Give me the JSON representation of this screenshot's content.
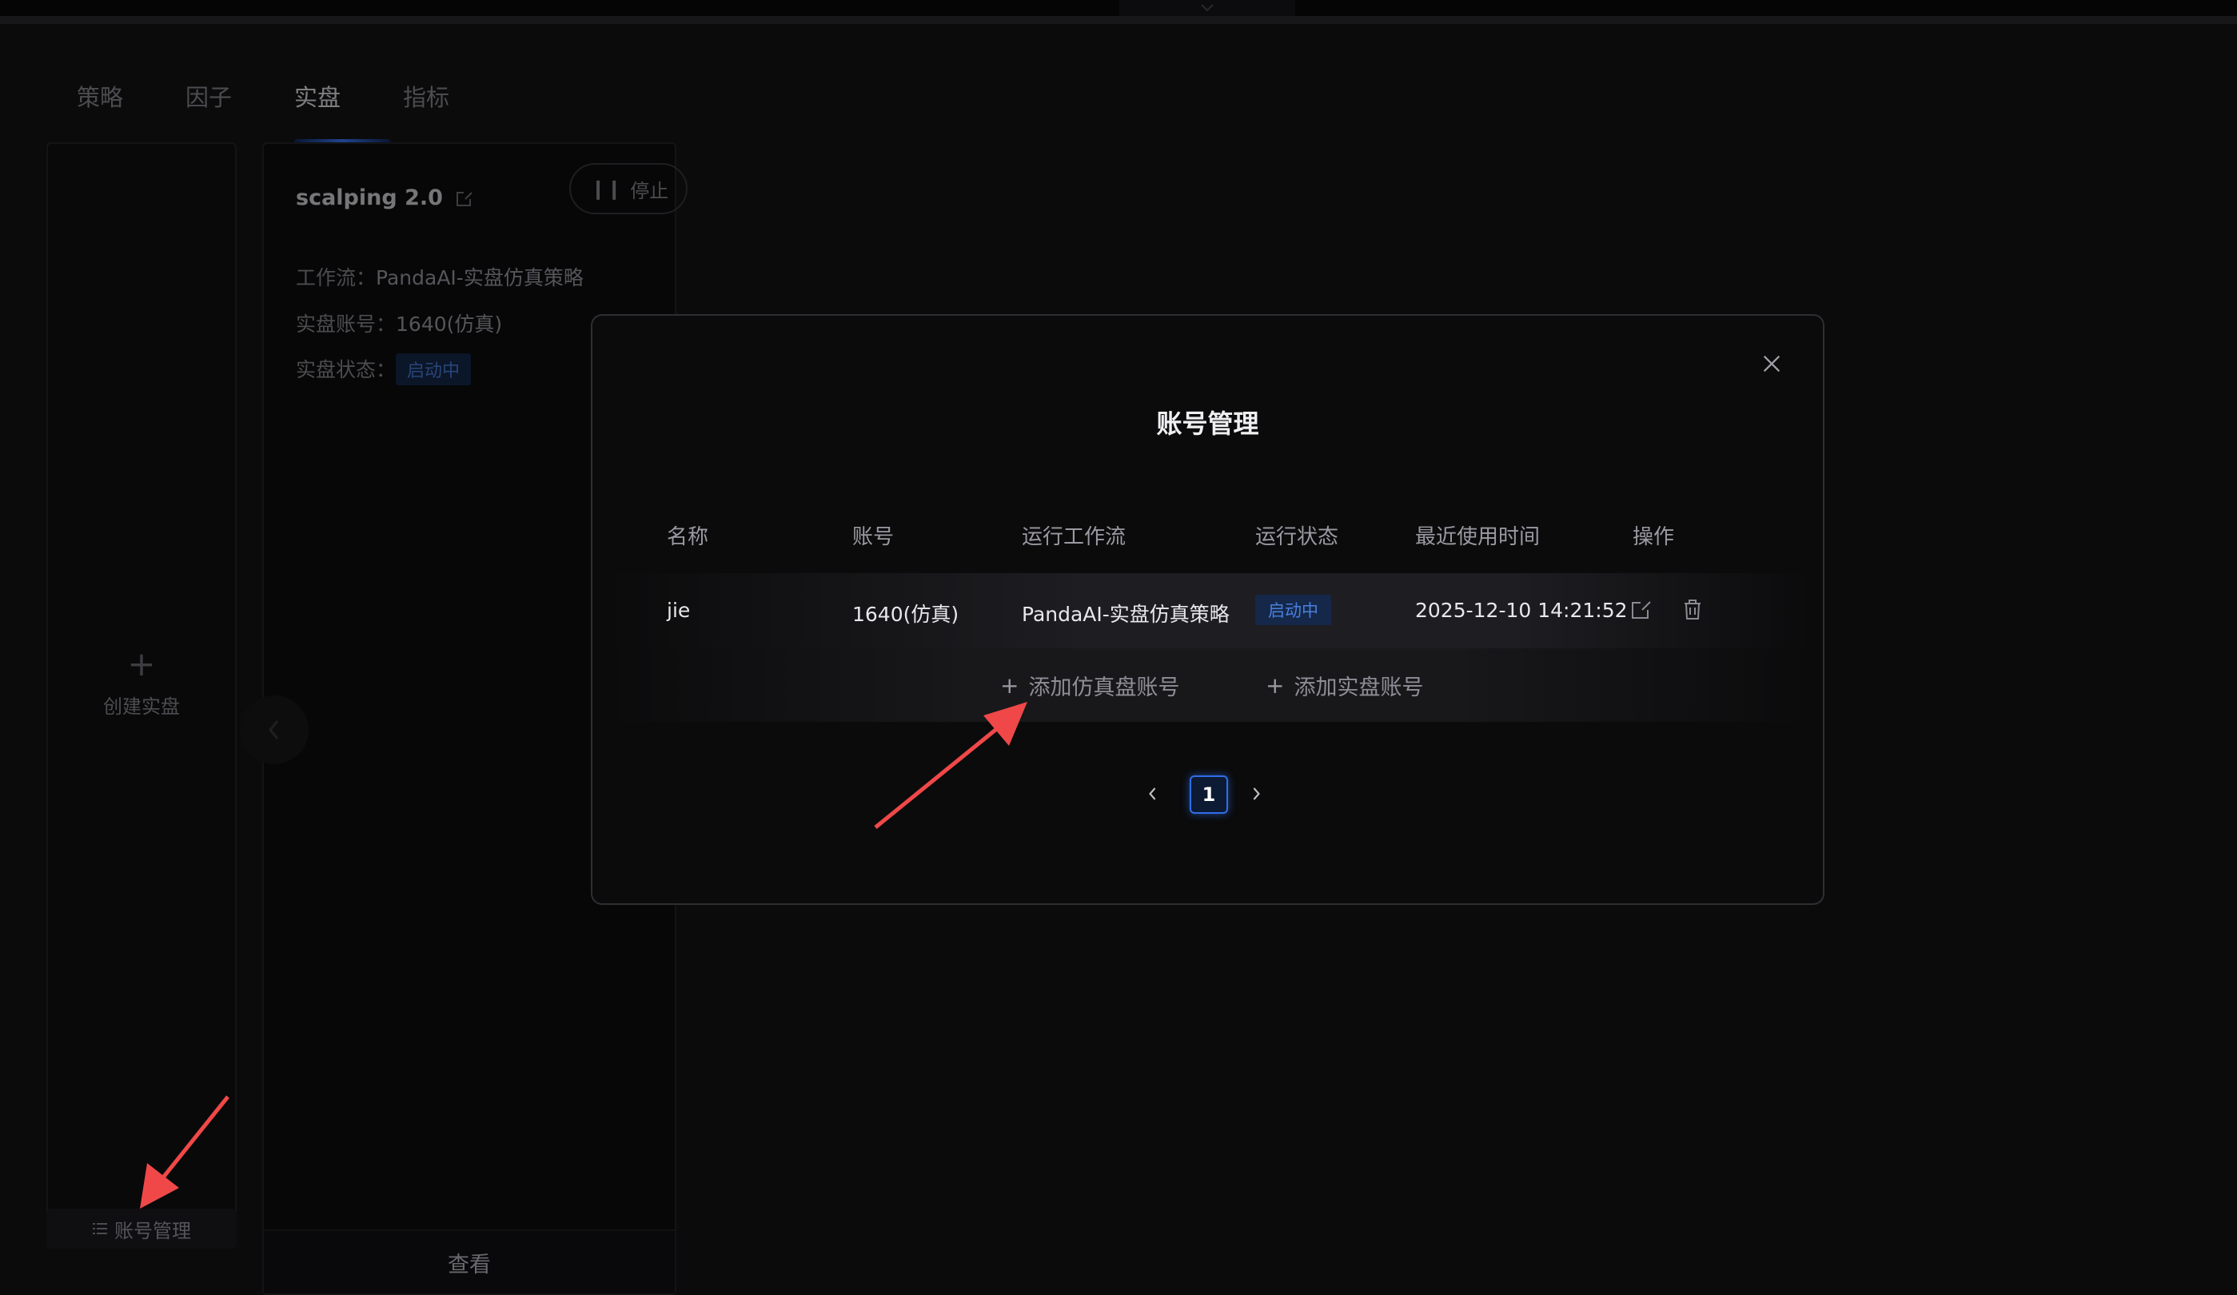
{
  "tabs": [
    {
      "label": "策略"
    },
    {
      "label": "因子"
    },
    {
      "label": "实盘"
    },
    {
      "label": "指标"
    }
  ],
  "sidebar": {
    "create_label": "创建实盘",
    "account_mgmt_label": "账号管理"
  },
  "strategy_card": {
    "title": "scalping 2.0",
    "stop_label": "停止",
    "workflow_label": "工作流：",
    "workflow_value": "PandaAI-实盘仿真策略",
    "account_label": "实盘账号：",
    "account_value": "1640(仿真)",
    "status_label": "实盘状态：",
    "status_value": "启动中",
    "view_label": "查看"
  },
  "modal": {
    "title": "账号管理",
    "columns": [
      "名称",
      "账号",
      "运行工作流",
      "运行状态",
      "最近使用时间",
      "操作"
    ],
    "rows": [
      {
        "name": "jie",
        "account": "1640(仿真)",
        "workflow": "PandaAI-实盘仿真策略",
        "status": "启动中",
        "last_used": "2025-12-10 14:21:52"
      }
    ],
    "add_sim_label": "添加仿真盘账号",
    "add_real_label": "添加实盘账号",
    "add_icon": "+",
    "current_page": "1"
  },
  "colors": {
    "accent": "#2f6ee8",
    "status_bg": "#15284a",
    "status_text": "#4a7fdc",
    "annotation_arrow": "#f04848"
  }
}
